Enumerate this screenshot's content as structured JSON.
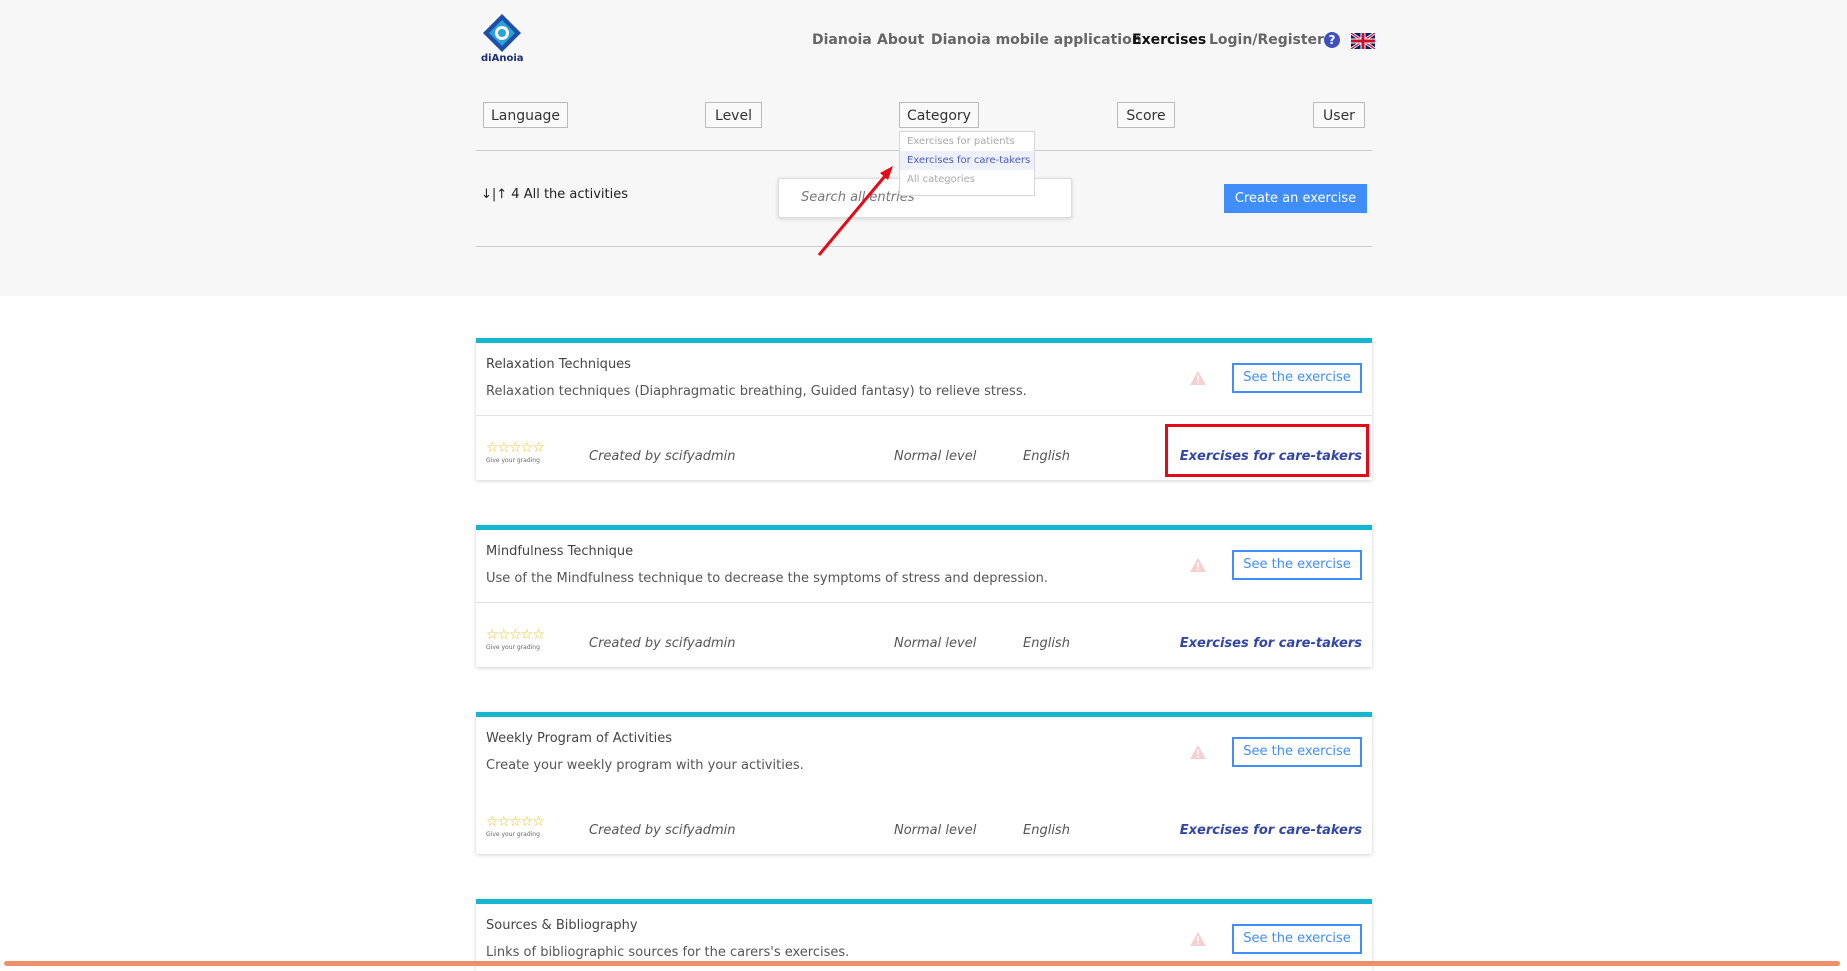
{
  "header": {
    "logo_text": "diAnoia",
    "nav": [
      "Dianoia",
      "About",
      "Dianoia mobile application",
      "Exercises",
      "Login/Register"
    ],
    "active_nav": "Exercises",
    "help_symbol": "?",
    "flag_icon": "uk-flag-icon"
  },
  "filters": {
    "language": "Language",
    "level": "Level",
    "category": "Category",
    "score": "Score",
    "user": "User"
  },
  "category_dropdown": {
    "options": [
      "Exercises for patients",
      "Exercises for care-takers",
      "All categories"
    ],
    "selected": "Exercises for care-takers"
  },
  "toolbar": {
    "sort_label": "↓|↑ 4 All the activities",
    "search_placeholder": "Search all entries",
    "create_button": "Create an exercise"
  },
  "exercises": [
    {
      "title": "Relaxation Techniques",
      "description": "Relaxation techniques (Diaphragmatic breathing, Guided fantasy) to relieve stress.",
      "see_button": "See the exercise",
      "grading_label": "Give your grading",
      "creator": "Created by scifyadmin",
      "level": "Normal level",
      "language": "English",
      "category": "Exercises for care-takers"
    },
    {
      "title": "Mindfulness Technique",
      "description": "Use of the Mindfulness technique to decrease the symptoms of stress and depression.",
      "see_button": "See the exercise",
      "grading_label": "Give your grading",
      "creator": "Created by scifyadmin",
      "level": "Normal level",
      "language": "English",
      "category": "Exercises for care-takers"
    },
    {
      "title": "Weekly Program of Activities",
      "description": "Create your weekly program with your activities.",
      "see_button": "See the exercise",
      "grading_label": "Give your grading",
      "creator": "Created by scifyadmin",
      "level": "Normal level",
      "language": "English",
      "category": "Exercises for care-takers"
    },
    {
      "title": "Sources & Bibliography",
      "description": "Links of bibliographic sources for the carers's exercises.",
      "see_button": "See the exercise"
    }
  ],
  "stars": "☆☆☆☆☆",
  "colors": {
    "accent": "#16b6cf",
    "primary": "#3f8efc",
    "category_text": "#3346a8",
    "highlight": "#e30b17"
  }
}
